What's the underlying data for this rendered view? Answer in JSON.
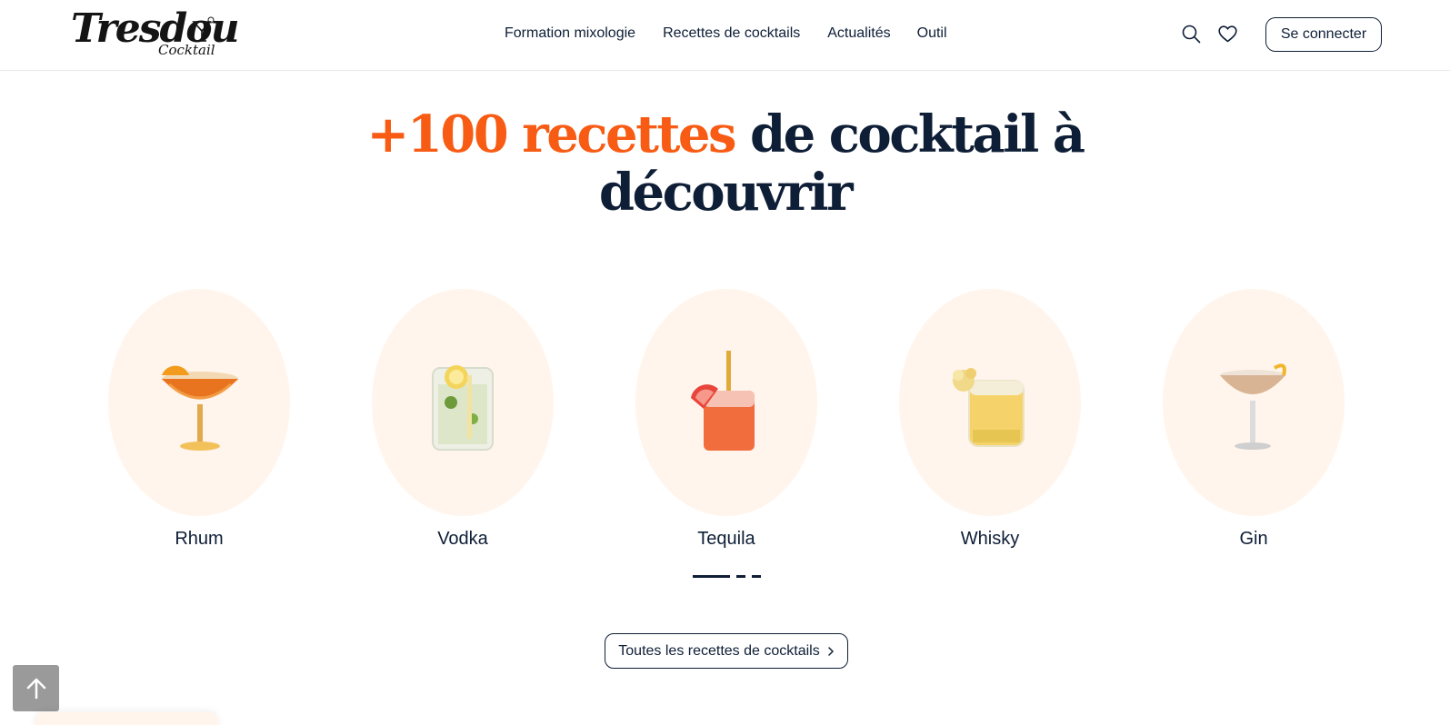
{
  "header": {
    "logo": {
      "main": "Tresdou",
      "sub": "Cocktail"
    },
    "nav": [
      {
        "label": "Formation mixologie"
      },
      {
        "label": "Recettes de cocktails"
      },
      {
        "label": "Actualités"
      },
      {
        "label": "Outil"
      }
    ],
    "icons": {
      "search": "search-icon",
      "favorites": "heart-icon"
    },
    "login_label": "Se connecter"
  },
  "hero": {
    "title_accent": "+100 recettes",
    "title_rest": " de cocktail à",
    "title_line2": "découvrir"
  },
  "categories": [
    {
      "label": "Rhum"
    },
    {
      "label": "Vodka"
    },
    {
      "label": "Tequila"
    },
    {
      "label": "Whisky"
    },
    {
      "label": "Gin"
    }
  ],
  "carousel": {
    "active_index": 0,
    "count": 3
  },
  "cta": {
    "label": "Toutes les recettes de cocktails",
    "icon": "chevron-right-icon"
  },
  "back_to_top": {
    "icon": "arrow-up-icon"
  },
  "colors": {
    "accent": "#f75b14",
    "navy": "#0e1e36",
    "cream": "#fff5ec"
  }
}
